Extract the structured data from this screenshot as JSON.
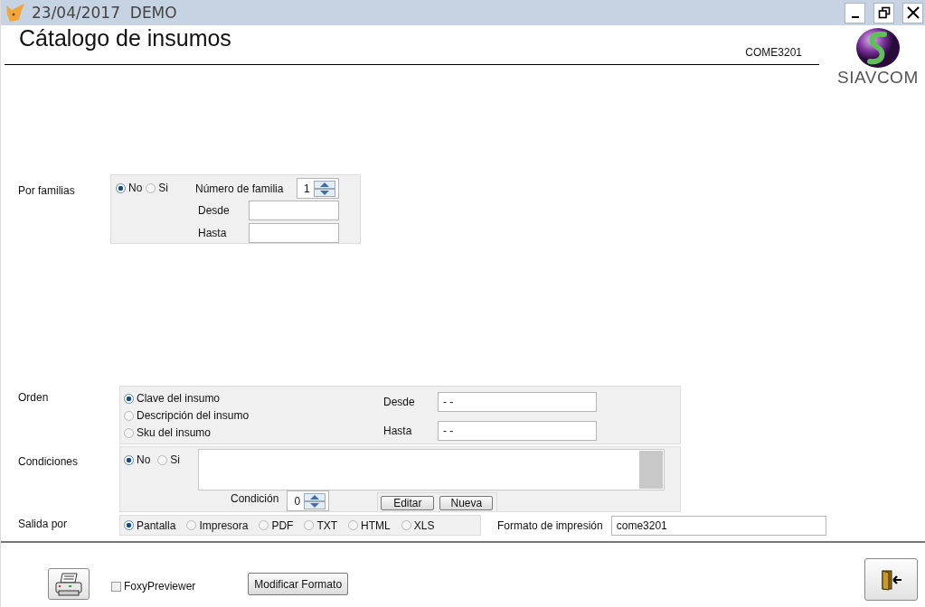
{
  "window": {
    "title": "23/04/2017  DEMO"
  },
  "header": {
    "title": "Cátalogo de insumos",
    "code": "COME3201",
    "logo_text": "SIAVCOM"
  },
  "por_familias": {
    "label": "Por familias",
    "options": [
      {
        "label": "No",
        "selected": true
      },
      {
        "label": "Si",
        "selected": false
      }
    ],
    "numero_label": "Número de familia",
    "numero_value": "1",
    "desde_label": "Desde",
    "hasta_label": "Hasta"
  },
  "orden": {
    "label": "Orden",
    "options": [
      {
        "label": "Clave del insumo",
        "selected": true
      },
      {
        "label": "Descripción del insumo",
        "selected": false
      },
      {
        "label": "Sku del insumo",
        "selected": false
      }
    ],
    "desde_label": "Desde",
    "desde_value": "- -",
    "hasta_label": "Hasta",
    "hasta_value": "- -"
  },
  "condiciones": {
    "label": "Condiciones",
    "options": [
      {
        "label": "No",
        "selected": true
      },
      {
        "label": "Si",
        "selected": false
      }
    ],
    "condicion_label": "Condición",
    "condicion_value": "0",
    "buttons": [
      "Editar",
      "Nueva"
    ]
  },
  "salida": {
    "label": "Salida por",
    "options": [
      {
        "label": "Pantalla",
        "selected": true
      },
      {
        "label": "Impresora",
        "selected": false
      },
      {
        "label": "PDF",
        "selected": false
      },
      {
        "label": "TXT",
        "selected": false
      },
      {
        "label": "HTML",
        "selected": false
      },
      {
        "label": "XLS",
        "selected": false
      }
    ],
    "formato_label": "Formato de impresión",
    "formato_value": "come3201"
  },
  "footer": {
    "foxy": {
      "label": "FoxyPreviewer",
      "checked": false
    },
    "modify_button": "Modificar Formato"
  }
}
